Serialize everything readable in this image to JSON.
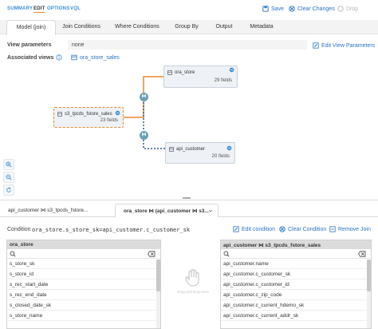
{
  "top_tabs": {
    "summary": "SUMMARY",
    "edit": "EDIT",
    "options": "OPTIONS",
    "vql": "VQL"
  },
  "actions": {
    "save": "Save",
    "clear_changes": "Clear Changes",
    "drop": "Drop"
  },
  "subtabs": [
    "Model (join)",
    "Join Conditions",
    "Where Conditions",
    "Group By",
    "Output",
    "Metadata"
  ],
  "view_parameters": {
    "label": "View parameters",
    "value": "none",
    "edit_label": "Edit View Parameters"
  },
  "associated_views": {
    "label": "Associated views",
    "value": "ora_store_sales"
  },
  "nodes": {
    "ora_store": {
      "name": "ora_store",
      "fields": "29 fields"
    },
    "s3_tpcds": {
      "name": "s3_tpcds_fstore_sales",
      "fields": "23 fields"
    },
    "api_customer": {
      "name": "api_customer",
      "fields": "20 fields"
    }
  },
  "bottom_tabs": [
    "api_customer ⋈ s3_tpcds_fstore...",
    "ora_store ⋈ (api_customer ⋈ s3..."
  ],
  "condition": {
    "label": "Condition",
    "expression": "ora_store.s_store_sk=api_customer.c_customer_sk",
    "edit": "Edit condition",
    "clear": "Clear Condition",
    "remove": "Remove Join"
  },
  "left_panel": {
    "title": "ora_store",
    "rows": [
      "s_store_sk",
      "s_store_id",
      "s_rec_start_date",
      "s_rec_end_date",
      "s_closed_date_sk",
      "s_store_name"
    ]
  },
  "middle": {
    "drag_text": "Drag and Drop here"
  },
  "right_panel": {
    "title": "api_customer ⋈ s3_tpcds_fstore_sales",
    "rows": [
      "api_customer.name",
      "api_customer.c_customer_sk",
      "api_customer.c_customer_id",
      "api_customer.c_zip_code",
      "api_customer.c_current_hdemo_sk",
      "api_customer.c_current_addr_sk"
    ]
  },
  "colors": {
    "accent_orange": "#e9892b",
    "link_blue": "#2b74c7",
    "join_node_teal": "#6aa0b8"
  }
}
